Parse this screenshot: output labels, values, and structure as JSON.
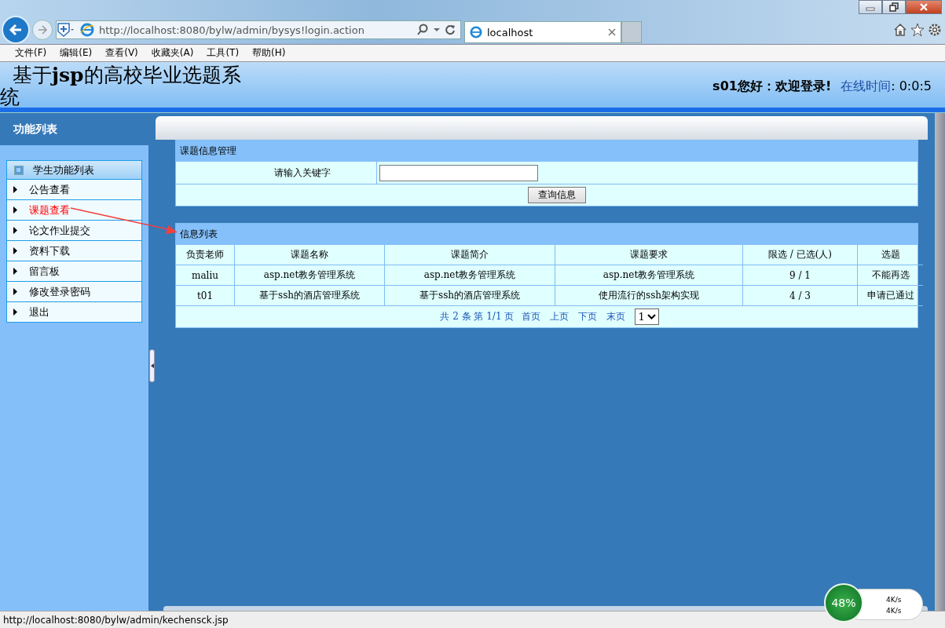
{
  "browser": {
    "url": "http://localhost:8080/bylw/admin/bysys!login.action",
    "tabs": [
      {
        "label": "localhost",
        "selected": true
      }
    ],
    "menu": [
      "文件(F)",
      "编辑(E)",
      "查看(V)",
      "收藏夹(A)",
      "工具(T)",
      "帮助(H)"
    ]
  },
  "header": {
    "title": "基于**jsp**的高校毕业选题系统",
    "greeting": "**s01**您好：欢迎登录!",
    "online_label": "在线时间",
    "online_value": ": 0:0:5"
  },
  "sidebar": {
    "title": "功能列表",
    "group": "学生功能列表",
    "items": [
      {
        "label": "公告查看",
        "selected": false
      },
      {
        "label": "课题查看",
        "selected": true
      },
      {
        "label": "论文作业提交",
        "selected": false
      },
      {
        "label": "资料下载",
        "selected": false
      },
      {
        "label": "留言板",
        "selected": false
      },
      {
        "label": "修改登录密码",
        "selected": false
      },
      {
        "label": "退出",
        "selected": false
      }
    ]
  },
  "search_panel": {
    "title": "课题信息管理",
    "label": "请输入关键字",
    "button": "查询信息"
  },
  "list_panel": {
    "title": "信息列表",
    "columns": [
      "负责老师",
      "课题名称",
      "课题简介",
      "课题要求",
      "限选 / 已选(人)",
      "选题"
    ],
    "rows": [
      [
        "maliu",
        "asp.net教务管理系统",
        "asp.net教务管理系统",
        "asp.net教务管理系统",
        "9 / 1",
        "不能再选"
      ],
      [
        "t01",
        "基于ssh的酒店管理系统",
        "基于ssh的酒店管理系统",
        "使用流行的ssh架构实现",
        "4 / 3",
        "申请已通过"
      ]
    ],
    "pagination": {
      "summary": "共 2 条 第 1/1 页",
      "links": [
        "首页",
        "上页",
        "下页",
        "末页"
      ],
      "page": "1"
    }
  },
  "status_bar": "http://localhost:8080/bylw/admin/kechensck.jsp",
  "widget": {
    "percent": "48%",
    "up": "4K/s",
    "down": "4K/s"
  }
}
